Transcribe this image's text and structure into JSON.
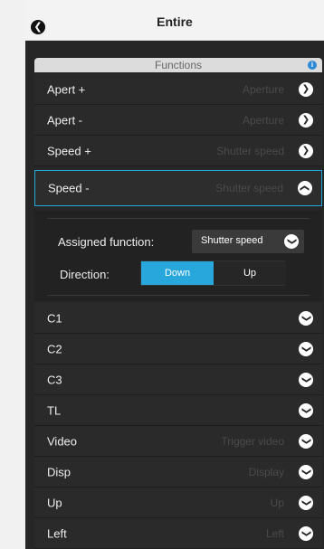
{
  "header": {
    "title": "Entire",
    "back_icon": "chevron-left-icon"
  },
  "section": {
    "title": "Functions",
    "info_icon": "info-icon"
  },
  "rows": [
    {
      "label": "Apert +",
      "value": "Aperture"
    },
    {
      "label": "Apert -",
      "value": "Aperture"
    },
    {
      "label": "Speed +",
      "value": "Shutter speed"
    },
    {
      "label": "Speed -",
      "value": "Shutter speed",
      "expanded": true
    },
    {
      "label": "C1",
      "value": ""
    },
    {
      "label": "C2",
      "value": ""
    },
    {
      "label": "C3",
      "value": ""
    },
    {
      "label": "TL",
      "value": ""
    },
    {
      "label": "Video",
      "value": "Trigger video"
    },
    {
      "label": "Disp",
      "value": "Display"
    },
    {
      "label": "Up",
      "value": "Up"
    },
    {
      "label": "Left",
      "value": "Left"
    }
  ],
  "detail": {
    "assigned_label": "Assigned function:",
    "assigned_value": "Shutter speed",
    "direction_label": "Direction:",
    "direction_options": [
      "Down",
      "Up"
    ],
    "direction_selected": "Down"
  },
  "colors": {
    "accent": "#28a7dd",
    "panel_bg": "#262626",
    "header_bg": "#f3f3f3"
  }
}
